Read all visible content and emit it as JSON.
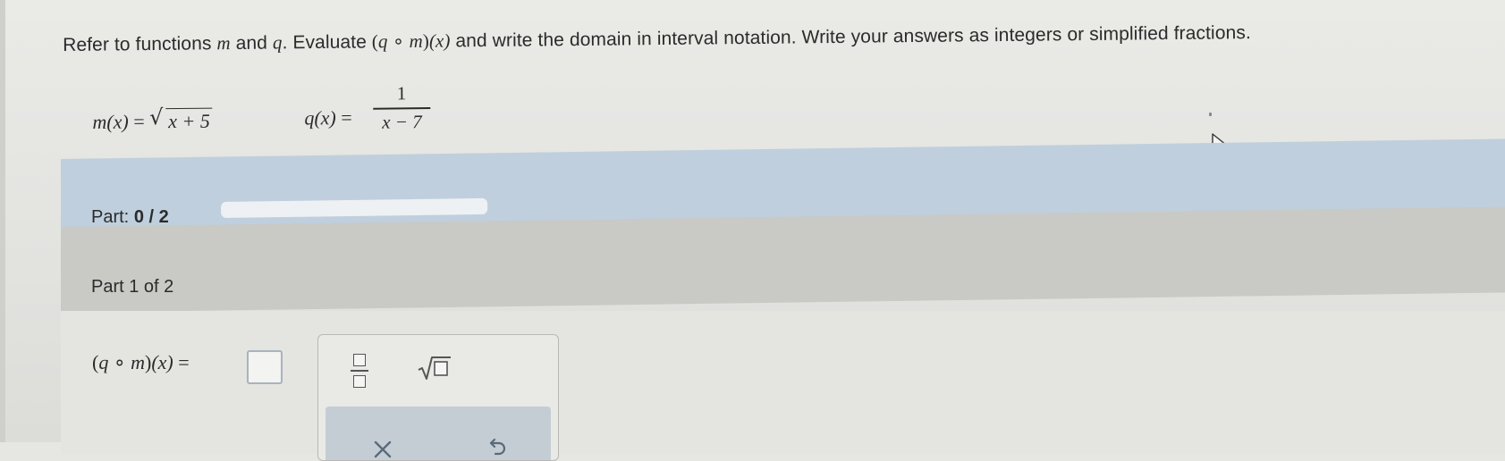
{
  "instruction": {
    "prefix": "Refer to functions ",
    "fn1": "m",
    "and": " and ",
    "fn2": "q",
    "evaluate": ". Evaluate ",
    "comp_open": "(",
    "comp_q": "q",
    "comp_circ": " ∘ ",
    "comp_m": "m",
    "comp_close": ")",
    "comp_x": "(x)",
    "rest": " and write the domain in interval notation. Write your answers as integers or simplified fractions."
  },
  "functions": {
    "m_lhs_name": "m",
    "m_lhs_arg": "(x)",
    "m_eq": " = ",
    "m_radicand": "x + 5",
    "q_lhs_name": "q",
    "q_lhs_arg": "(x)",
    "q_eq": " = ",
    "q_numerator": "1",
    "q_denominator": "x − 7"
  },
  "progress": {
    "label": "Part:",
    "value": "0 / 2",
    "fraction_complete": 0
  },
  "part": {
    "title": "Part 1 of 2"
  },
  "answer": {
    "lhs_open": "(",
    "lhs_q": "q",
    "lhs_circ": " ∘ ",
    "lhs_m": "m",
    "lhs_close": ")",
    "lhs_x": "(x)",
    "lhs_eq": " = "
  },
  "toolbar": {
    "fraction_icon": "fraction-template-icon",
    "sqrt_icon": "square-root-template-icon",
    "clear_icon": "clear-x-icon",
    "undo_icon": "undo-arrow-icon"
  },
  "colors": {
    "progress_bar_bg": "#bfcfdd",
    "part_header_bg": "#c9c9c6",
    "actions_bg": "#c5cdd4"
  }
}
